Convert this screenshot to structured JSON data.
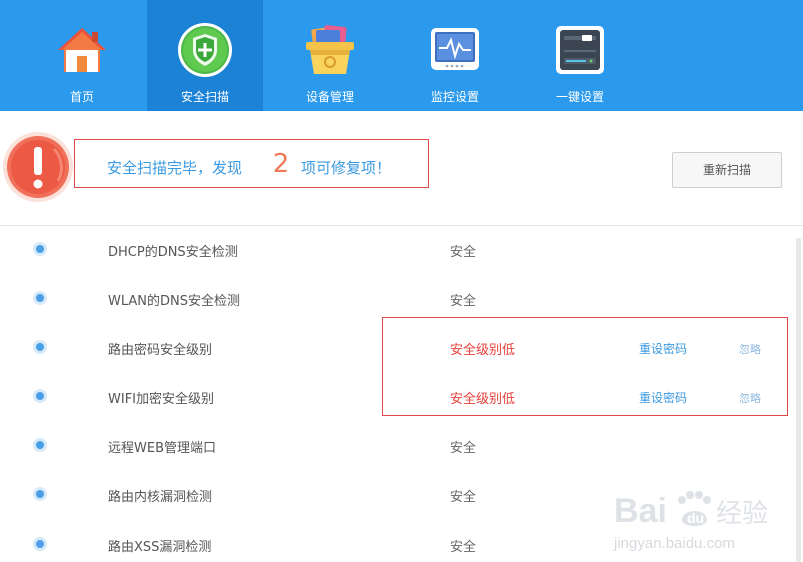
{
  "nav": {
    "items": [
      {
        "label": "首页",
        "icon": "home-icon"
      },
      {
        "label": "安全扫描",
        "icon": "shield-plus-icon"
      },
      {
        "label": "设备管理",
        "icon": "basket-icon"
      },
      {
        "label": "监控设置",
        "icon": "monitor-chart-icon"
      },
      {
        "label": "一键设置",
        "icon": "router-panel-icon"
      }
    ],
    "active_index": 1
  },
  "result": {
    "prefix": "安全扫描完毕，发现",
    "count": "2",
    "suffix": "项可修复项！",
    "rescan_label": "重新扫描"
  },
  "items": [
    {
      "name": "DHCP的DNS安全检测",
      "status": "安全"
    },
    {
      "name": "WLAN的DNS安全检测",
      "status": "安全"
    },
    {
      "name": "路由密码安全级别",
      "status": "安全级别低",
      "action": "重设密码",
      "ignore": "忽略"
    },
    {
      "name": "WIFI加密安全级别",
      "status": "安全级别低",
      "action": "重设密码",
      "ignore": "忽略"
    },
    {
      "name": "远程WEB管理端口",
      "status": "安全"
    },
    {
      "name": "路由内核漏洞检测",
      "status": "安全"
    },
    {
      "name": "路由XSS漏洞检测",
      "status": "安全"
    }
  ],
  "watermark": {
    "brand": "Baidu经验",
    "url": "jingyan.baidu.com"
  },
  "colors": {
    "topbar": "#2b99ec",
    "active_tab": "#1b82d6",
    "accent_text": "#3b9ae1",
    "warning": "#e8413a"
  }
}
